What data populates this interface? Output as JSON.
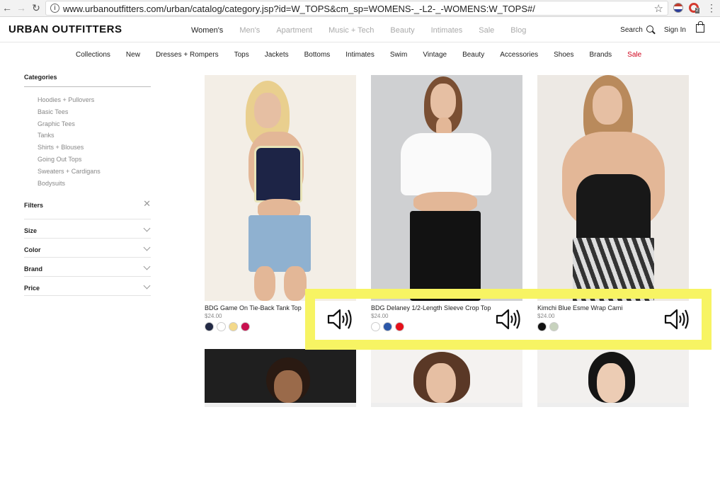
{
  "browser": {
    "url": "www.urbanoutfitters.com/urban/catalog/category.jsp?id=W_TOPS&cm_sp=WOMENS-_-L2-_-WOMENS:W_TOPS#/",
    "ext_badge": "2"
  },
  "header": {
    "logo": "URBAN OUTFITTERS",
    "nav": [
      "Women's",
      "Men's",
      "Apartment",
      "Music + Tech",
      "Beauty",
      "Intimates",
      "Sale",
      "Blog"
    ],
    "search_label": "Search",
    "signin_label": "Sign In"
  },
  "subnav": [
    "Collections",
    "New",
    "Dresses + Rompers",
    "Tops",
    "Jackets",
    "Bottoms",
    "Intimates",
    "Swim",
    "Vintage",
    "Beauty",
    "Accessories",
    "Shoes",
    "Brands",
    "Sale"
  ],
  "sidebar": {
    "categories_title": "Categories",
    "categories": [
      "Hoodies + Pullovers",
      "Basic Tees",
      "Graphic Tees",
      "Tanks",
      "Shirts + Blouses",
      "Going Out Tops",
      "Sweaters + Cardigans",
      "Bodysuits"
    ],
    "filters_title": "Filters",
    "filters": [
      "Size",
      "Color",
      "Brand",
      "Price"
    ]
  },
  "products": [
    {
      "name": "BDG Game On Tie-Back Tank Top",
      "price": "$24.00",
      "swatches": [
        "#232a45",
        "#ffffff",
        "#f3d98a",
        "#c8104f"
      ]
    },
    {
      "name": "BDG Delaney 1/2-Length Sleeve Crop Top",
      "price": "$24.00",
      "swatches": [
        "#ffffff",
        "#2c57a8",
        "#e5101a"
      ]
    },
    {
      "name": "Kimchi Blue Esme Wrap Cami",
      "price": "$24.00",
      "swatches": [
        "#111111",
        "#c7d2bd"
      ]
    }
  ],
  "colors": {
    "highlight": "#f7f463",
    "sale": "#d0021b"
  },
  "icons": [
    "speaker-icon"
  ]
}
